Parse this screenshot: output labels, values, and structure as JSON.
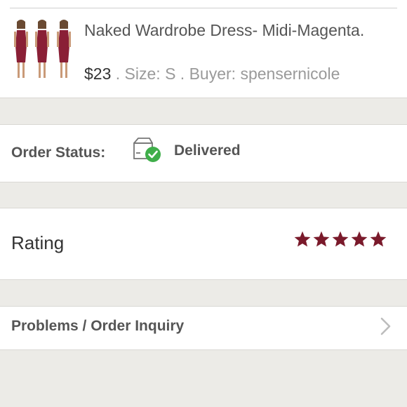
{
  "product": {
    "title": "Naked Wardrobe Dress- Midi-Magenta.",
    "price": "$23",
    "details": " . Size: S . Buyer: spensernicole"
  },
  "order_status": {
    "label": "Order Status:",
    "value": "Delivered",
    "icon": "package-delivered-icon",
    "check_color": "#3fae4a"
  },
  "rating": {
    "label": "Rating",
    "stars": 5,
    "max_stars": 5,
    "star_color": "#7a1a2b"
  },
  "inquiry": {
    "label": "Problems / Order Inquiry",
    "icon": "chevron-right-icon"
  }
}
